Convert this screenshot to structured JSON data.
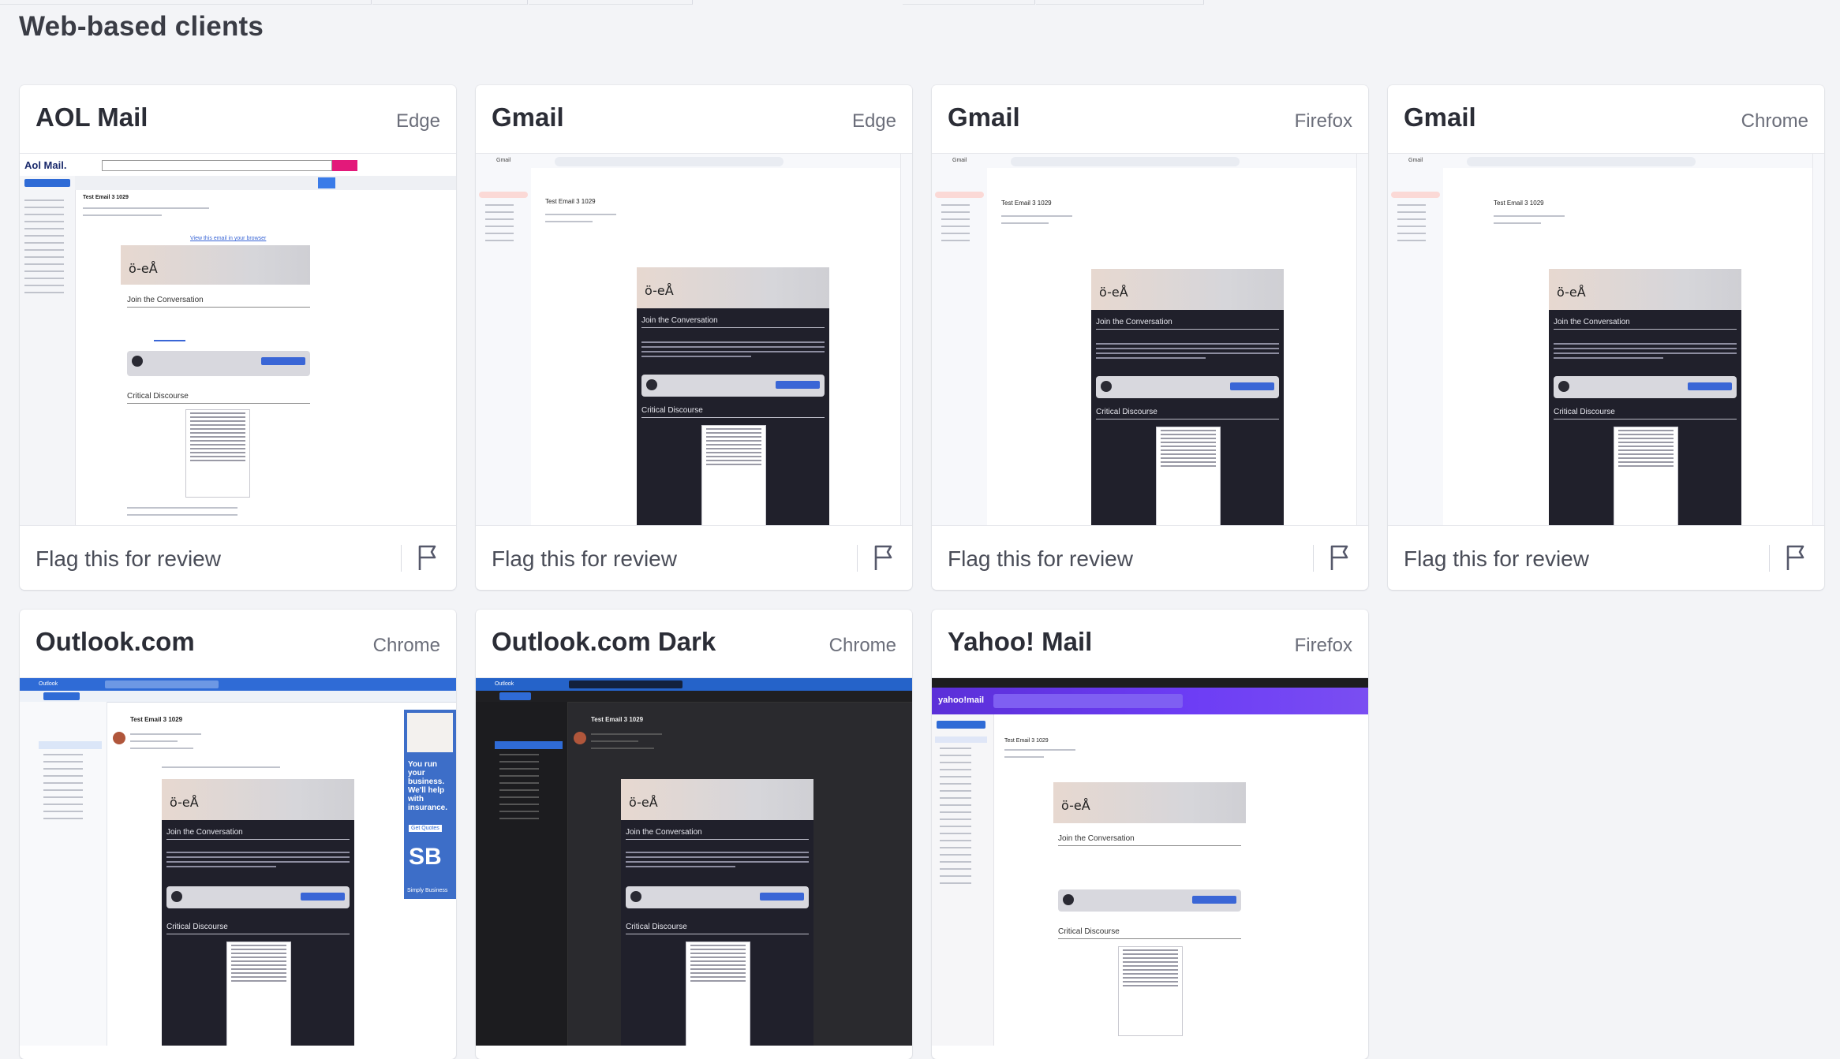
{
  "section": {
    "title": "Web-based clients"
  },
  "footer": {
    "flag_label": "Flag this for review"
  },
  "cards": [
    {
      "title": "AOL Mail",
      "browser": "Edge",
      "kind": "aol"
    },
    {
      "title": "Gmail",
      "browser": "Edge",
      "kind": "gmail"
    },
    {
      "title": "Gmail",
      "browser": "Firefox",
      "kind": "gmail"
    },
    {
      "title": "Gmail",
      "browser": "Chrome",
      "kind": "gmail"
    },
    {
      "title": "Outlook.com",
      "browser": "Chrome",
      "kind": "outlook"
    },
    {
      "title": "Outlook.com Dark",
      "browser": "Chrome",
      "kind": "outlook-dark"
    },
    {
      "title": "Yahoo! Mail",
      "browser": "Firefox",
      "kind": "yahoo"
    }
  ],
  "email": {
    "subject": "Test Email 3 1029",
    "heading": "Join the Conversation",
    "section2": "Critical Discourse",
    "logo": "ö-eÅ",
    "view_online": "View this email in your browser"
  },
  "aol": {
    "brand": "Aol Mail."
  },
  "gmail": {
    "brand": "Gmail"
  },
  "outlook": {
    "brand": "Outlook",
    "ad_text": "You run your business. We'll help with insurance.",
    "ad_cta": "Get Quotes",
    "ad_brand": "Simply Business"
  },
  "yahoo": {
    "brand": "yahoo!mail"
  },
  "colors": {
    "accent_blue": "#2f6bd6",
    "aol_pink": "#e3197a",
    "yahoo_purple": "#6d3df5"
  }
}
